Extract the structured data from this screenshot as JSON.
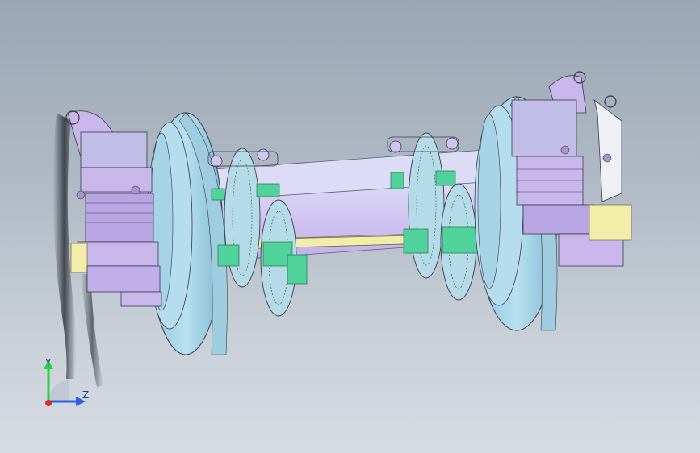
{
  "viewport": {
    "colors": {
      "bg_top": "#9aa6b4",
      "bg_bottom": "#d7dce2",
      "body_lavender": "#c9b7ec",
      "body_lavender_dark": "#a893d6",
      "wheel_cyan": "#a8d5e8",
      "wheel_cyan_dark": "#7fb8d2",
      "axle_lilac": "#cfc4f2",
      "axle_light": "#dcdcf6",
      "link_yellow": "#f2eeaa",
      "bracket_green": "#4fd39a",
      "outline": "#3a3a4a"
    }
  },
  "triad": {
    "y_label": "Y",
    "z_label": "Z",
    "colors": {
      "y": "#2bd04a",
      "z": "#2f5fe8",
      "x": "#e02a2a"
    }
  }
}
